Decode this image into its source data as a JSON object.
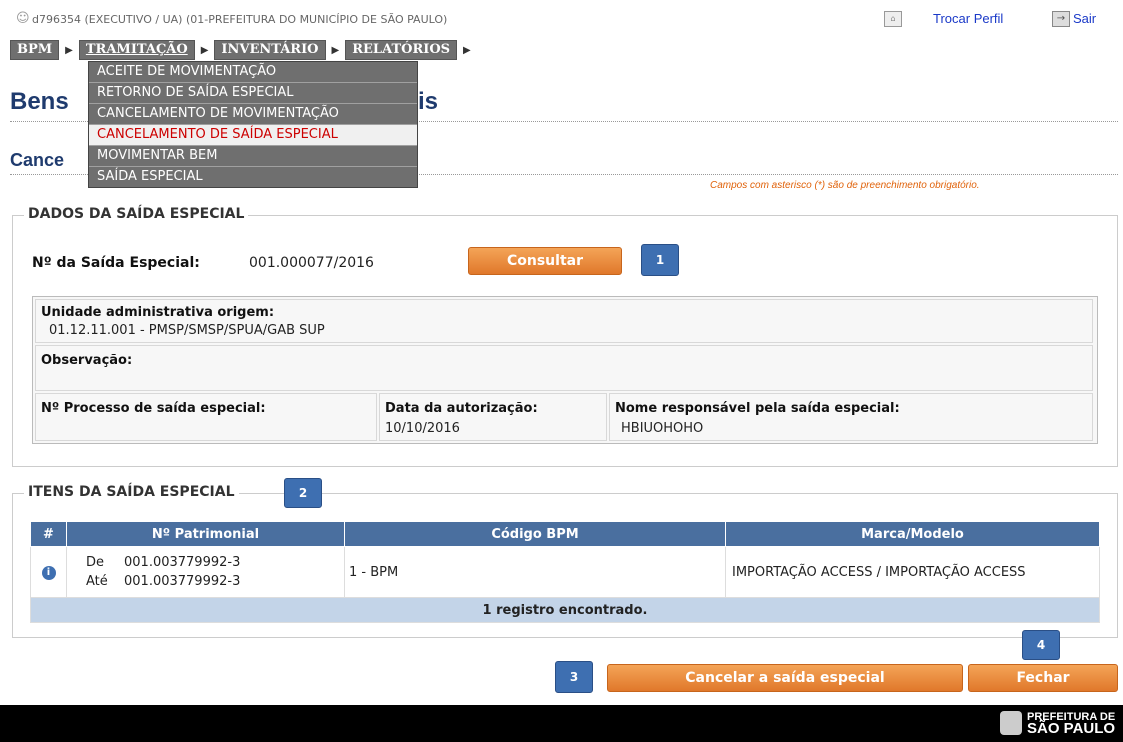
{
  "topbar": {
    "user_info": "d796354 (EXECUTIVO / UA) (01-PREFEITURA DO MUNICÍPIO DE SÃO PAULO)",
    "trocar_perfil": "Trocar Perfil",
    "sair": "Sair"
  },
  "nav": {
    "items": [
      "BPM",
      "TRAMITAÇÃO",
      "INVENTÁRIO",
      "RELATÓRIOS"
    ]
  },
  "dropdown": {
    "items": [
      "ACEITE DE MOVIMENTAÇÃO",
      "RETORNO DE SAÍDA ESPECIAL",
      "CANCELAMENTO DE MOVIMENTAÇÃO",
      "CANCELAMENTO DE SAÍDA ESPECIAL",
      "MOVIMENTAR BEM",
      "SAÍDA ESPECIAL"
    ],
    "highlighted_index": 3
  },
  "page": {
    "title_part1": "Bens",
    "title_part2": "is",
    "subtitle": "Cance",
    "required_note": "Campos com asterisco (*) são de preenchimento obrigatório."
  },
  "dados": {
    "legend": "DADOS DA SAÍDA ESPECIAL",
    "num_label": "Nº da Saída Especial:",
    "num_value": "001.000077/2016",
    "consultar": "Consultar",
    "badge1": "1",
    "unidade_label": "Unidade administrativa origem:",
    "unidade_value": "01.12.11.001 - PMSP/SMSP/SPUA/GAB SUP",
    "observacao_label": "Observação:",
    "processo_label": "Nº Processo de saída especial:",
    "data_label": "Data da autorização:",
    "data_value": "10/10/2016",
    "responsavel_label": "Nome responsável pela saída especial:",
    "responsavel_value": "HBIUOHOHO"
  },
  "itens": {
    "legend": "ITENS DA SAÍDA ESPECIAL",
    "badge2": "2",
    "headers": [
      "#",
      "Nº Patrimonial",
      "Código BPM",
      "Marca/Modelo"
    ],
    "row": {
      "de_label": "De",
      "de_value": "001.003779992-3",
      "ate_label": "Até",
      "ate_value": "001.003779992-3",
      "codigo": "1 -  BPM",
      "marca": "IMPORTAÇÃO ACCESS  /  IMPORTAÇÃO ACCESS"
    },
    "footer": "1 registro encontrado."
  },
  "actions": {
    "badge3": "3",
    "badge4": "4",
    "cancelar": "Cancelar a saída especial",
    "fechar": "Fechar"
  },
  "footer": {
    "logo_line1": "PREFEITURA DE",
    "logo_line2": "SÃO PAULO"
  },
  "colors": {
    "accent_orange": "#e0782b",
    "badge_blue": "#3e6fb1",
    "nav_gray": "#6f6f6f",
    "heading_blue": "#1f3b6e"
  }
}
